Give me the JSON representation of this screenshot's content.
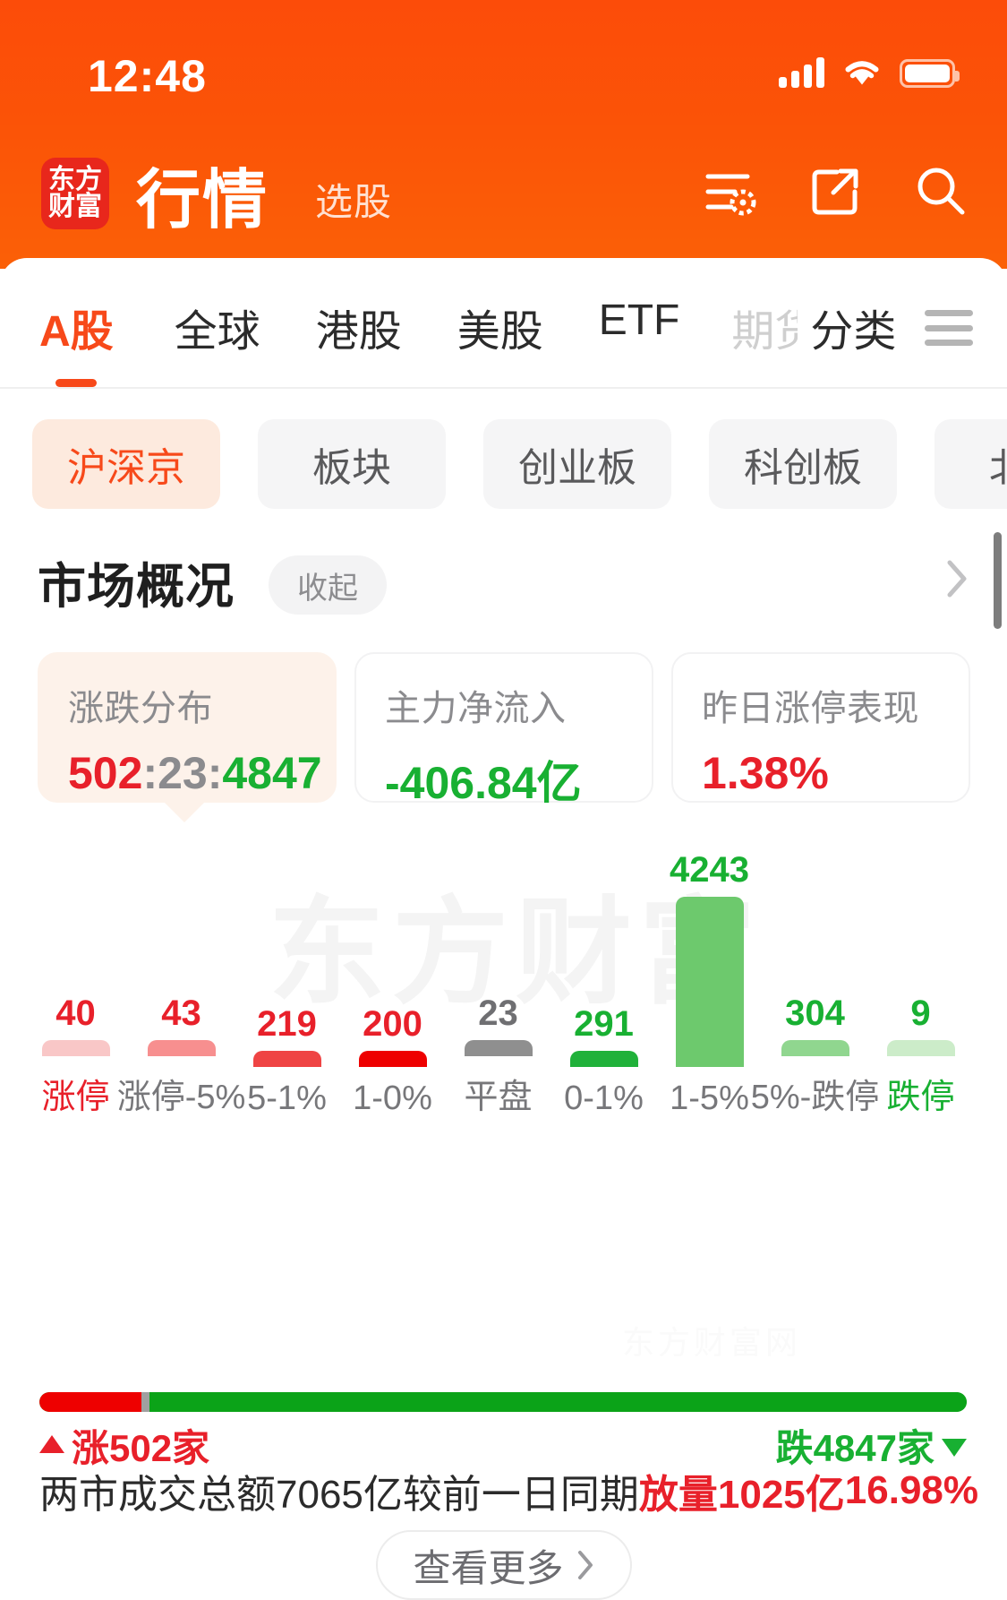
{
  "status_bar": {
    "time": "12:48",
    "signal_icon": "cellular-signal-icon",
    "wifi_icon": "wifi-icon",
    "battery_icon": "battery-full-icon"
  },
  "header": {
    "logo_line1": "东方",
    "logo_line2": "财富",
    "title": "行情",
    "subtitle": "选股",
    "actions": [
      {
        "name": "list-settings-icon",
        "label": "列表设置"
      },
      {
        "name": "external-link-icon",
        "label": "分享"
      },
      {
        "name": "search-icon",
        "label": "搜索"
      }
    ]
  },
  "market_tabs": {
    "items": [
      {
        "label": "A股",
        "active": true
      },
      {
        "label": "全球",
        "active": false
      },
      {
        "label": "港股",
        "active": false
      },
      {
        "label": "美股",
        "active": false
      },
      {
        "label": "ETF",
        "active": false
      },
      {
        "label": "期货",
        "active": false,
        "faded": true
      },
      {
        "label": "分类",
        "active": false
      }
    ],
    "menu_icon": "hamburger-menu-icon"
  },
  "filter_chips": [
    {
      "label": "沪深京",
      "active": true
    },
    {
      "label": "板块",
      "active": false
    },
    {
      "label": "创业板",
      "active": false
    },
    {
      "label": "科创板",
      "active": false
    },
    {
      "label": "北交",
      "active": false
    }
  ],
  "overview": {
    "title": "市场概况",
    "collapse_label": "收起",
    "arrow_icon": "chevron-right-icon"
  },
  "stat_cards": [
    {
      "label": "涨跌分布",
      "value_up": "502",
      "value_sep1": ":",
      "value_flat": "23",
      "value_sep2": ":",
      "value_down": "4847",
      "selected": true
    },
    {
      "label": "主力净流入",
      "value": "-406.84亿",
      "tone": "green",
      "selected": false
    },
    {
      "label": "昨日涨停表现",
      "value": "1.38%",
      "tone": "red",
      "selected": false
    }
  ],
  "chart_data": {
    "type": "bar",
    "title": "涨跌分布",
    "watermark": "东方财富",
    "xlabel": "",
    "ylabel": "",
    "grid": false,
    "ylim": [
      0,
      4243
    ],
    "categories": [
      "涨停",
      "涨停-5%",
      "5-1%",
      "1-0%",
      "平盘",
      "0-1%",
      "1-5%",
      "5%-跌停",
      "跌停"
    ],
    "values": [
      40,
      43,
      219,
      200,
      23,
      291,
      4243,
      304,
      9
    ],
    "bar_colors": [
      "#f9c7c7",
      "#f78f8f",
      "#ef4444",
      "#ee0000",
      "#8f8f8f",
      "#20b13a",
      "#6dc96d",
      "#90d68f",
      "#ccecc9"
    ],
    "label_colors": [
      "#e8202a",
      "#e8202a",
      "#e8202a",
      "#e8202a",
      "#6f6f72",
      "#18b032",
      "#18b032",
      "#18b032",
      "#18b032"
    ],
    "category_label_colors": [
      "red",
      "gray",
      "gray",
      "gray",
      "gray",
      "gray",
      "gray",
      "gray",
      "green"
    ]
  },
  "ratio": {
    "up_pct": 11.0,
    "flat_pct": 0.9,
    "down_pct": 88.1,
    "up_color": "#ee0000",
    "flat_color": "#a0a0a0",
    "down_color": "#0ba318"
  },
  "footer": {
    "up_text": "涨502家",
    "down_text": "跌4847家",
    "turnover_label": "两市成交总额",
    "turnover_value": "7065亿",
    "compare_label": "较前一日同期",
    "volume_change": "放量1025亿",
    "volume_pct": "16.98%",
    "view_more": "查看更多",
    "view_more_arrow": "chevron-right-icon",
    "bottom_watermark": "东方财富网"
  }
}
